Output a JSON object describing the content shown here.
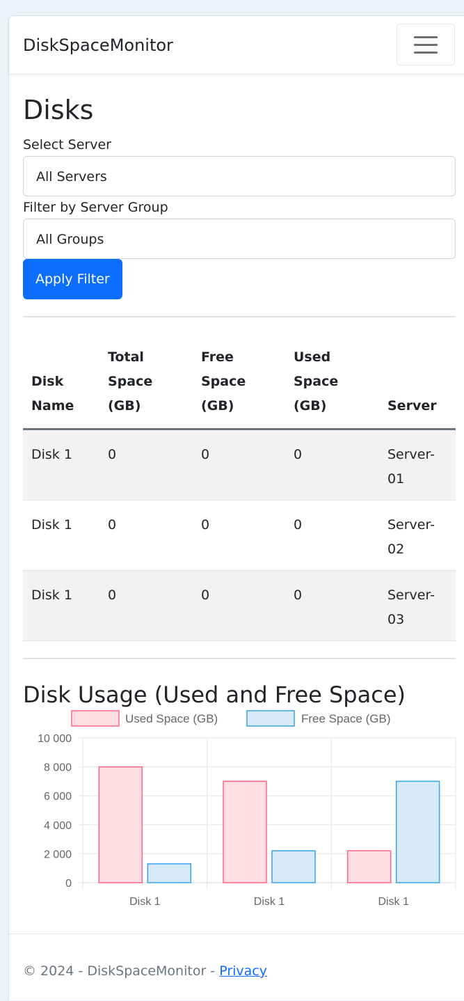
{
  "navbar": {
    "brand": "DiskSpaceMonitor",
    "toggle_icon": "hamburger-menu-icon"
  },
  "page": {
    "title": "Disks"
  },
  "filters": {
    "server_label": "Select Server",
    "server_value": "All Servers",
    "group_label": "Filter by Server Group",
    "group_value": "All Groups",
    "apply_label": "Apply Filter"
  },
  "table": {
    "headers": {
      "disk_name": "Disk Name",
      "total": "Total Space (GB)",
      "free": "Free Space (GB)",
      "used": "Used Space (GB)",
      "server": "Server"
    },
    "rows": [
      {
        "disk": "Disk 1",
        "total": "0",
        "free": "0",
        "used": "0",
        "server": "Server-01"
      },
      {
        "disk": "Disk 1",
        "total": "0",
        "free": "0",
        "used": "0",
        "server": "Server-02"
      },
      {
        "disk": "Disk 1",
        "total": "0",
        "free": "0",
        "used": "0",
        "server": "Server-03"
      }
    ]
  },
  "chart_section": {
    "title": "Disk Usage (Used and Free Space)"
  },
  "chart_data": {
    "type": "bar",
    "categories": [
      "Disk 1",
      "Disk 1",
      "Disk 1"
    ],
    "series": [
      {
        "name": "Used Space (GB)",
        "values": [
          8000,
          7000,
          2200
        ],
        "fill": "#ffdde3",
        "stroke": "#ff6384"
      },
      {
        "name": "Free Space (GB)",
        "values": [
          1300,
          2200,
          7000
        ],
        "fill": "#d6eaf8",
        "stroke": "#36a2eb"
      }
    ],
    "yticks": [
      "0",
      "2 000",
      "4 000",
      "6 000",
      "8 000",
      "10 000"
    ],
    "ylim": [
      0,
      10000
    ],
    "grid": true,
    "legend": "top"
  },
  "footer": {
    "text": "© 2024 - DiskSpaceMonitor - ",
    "privacy": "Privacy"
  }
}
